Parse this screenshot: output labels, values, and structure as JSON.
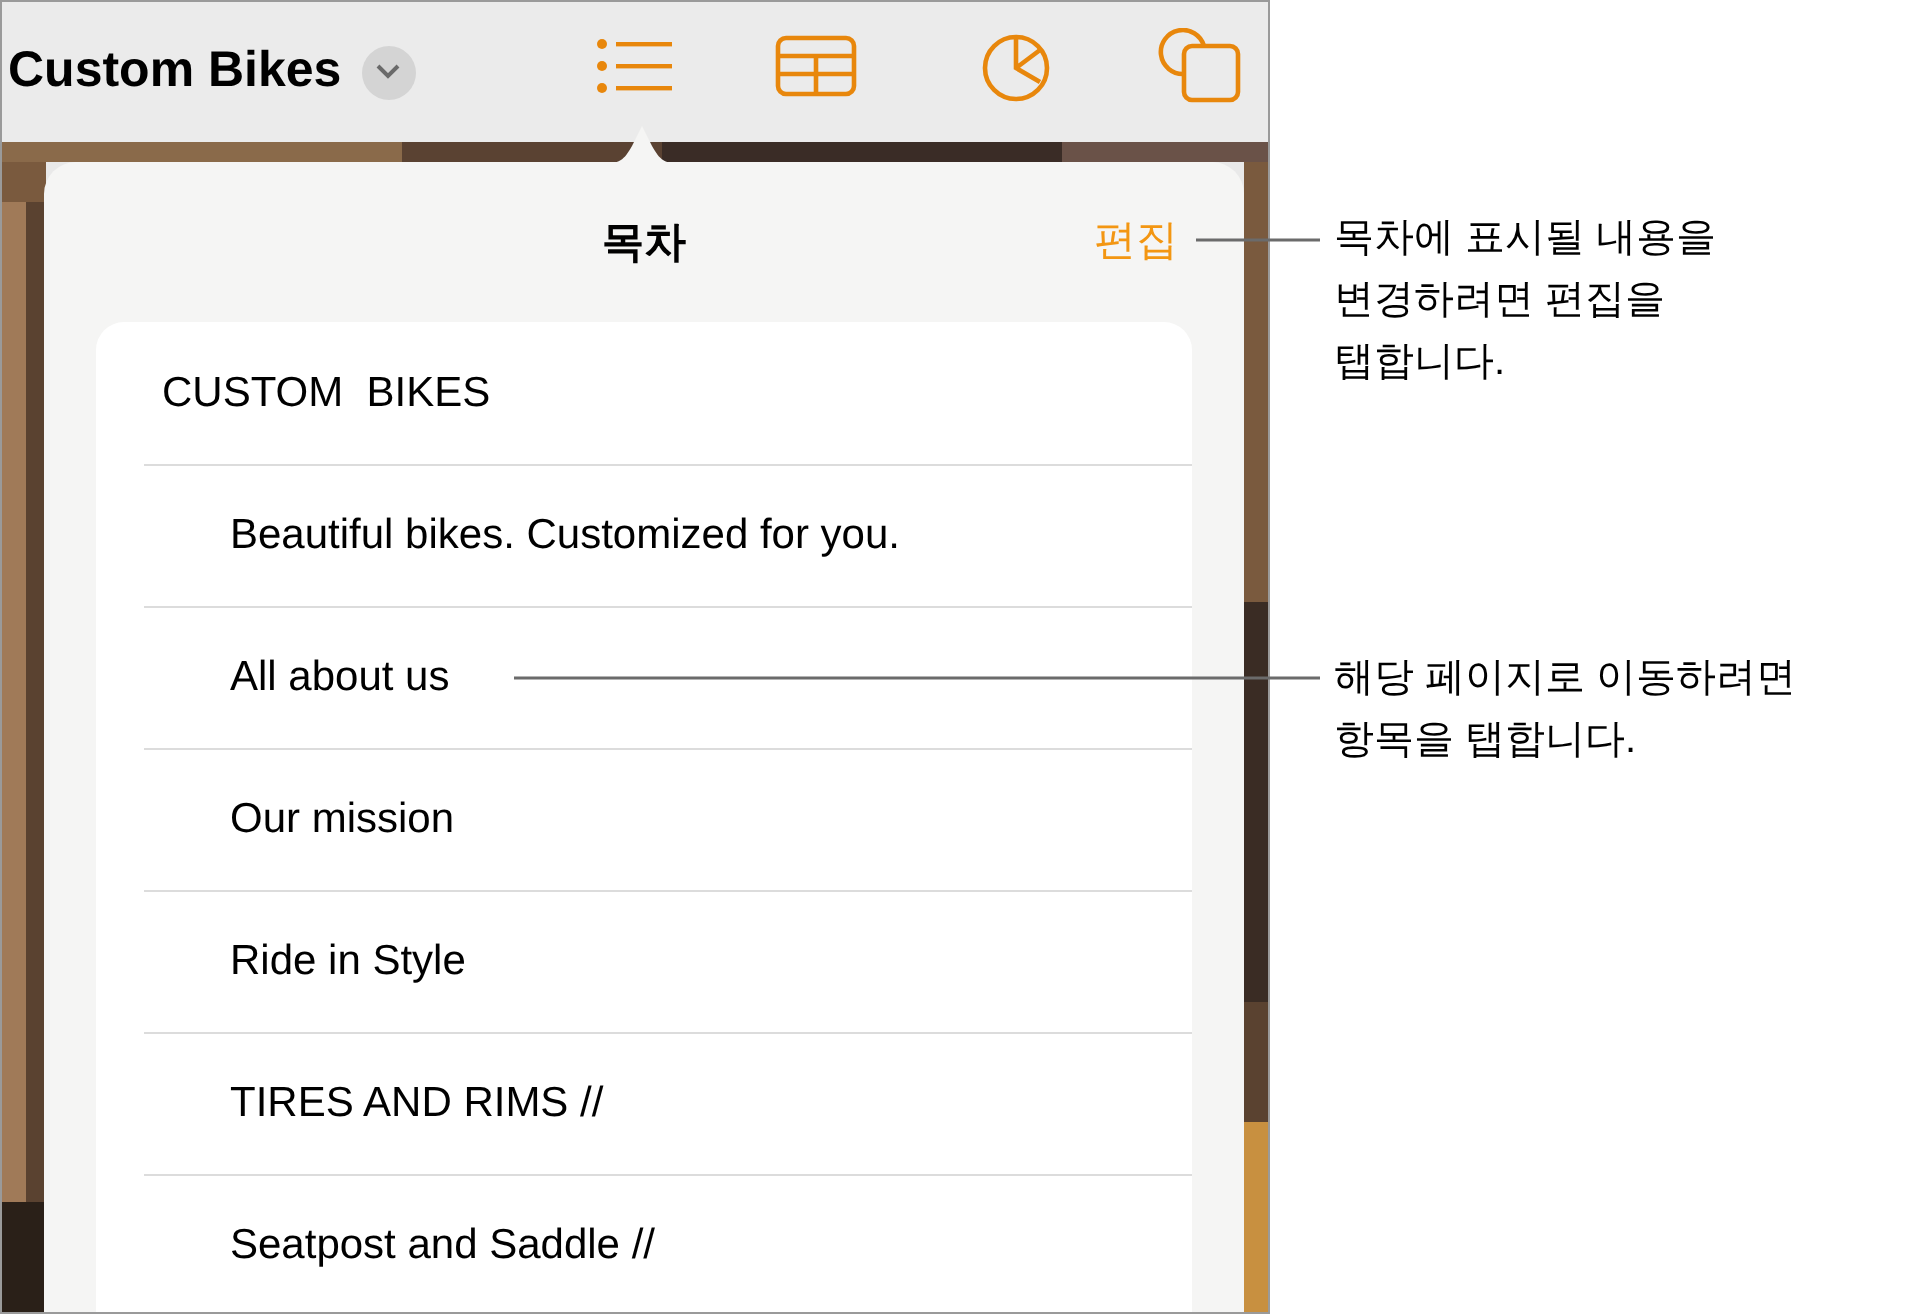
{
  "toolbar": {
    "document_title": "Custom Bikes"
  },
  "popover": {
    "title": "목차",
    "edit_button": "편집",
    "entries": [
      {
        "label": "CUSTOM  BIKES",
        "children": [
          {
            "label": "Beautiful bikes. Customized for you."
          },
          {
            "label": "All about us"
          },
          {
            "label": "Our mission"
          },
          {
            "label": "Ride in Style"
          },
          {
            "label": "TIRES AND RIMS //"
          },
          {
            "label": "Seatpost and Saddle //"
          }
        ]
      }
    ]
  },
  "callouts": [
    {
      "text": "목차에 표시될 내용을 변경하려면 편집을 탭합니다."
    },
    {
      "text": "해당 페이지로 이동하려면 항목을 탭합니다."
    }
  ]
}
